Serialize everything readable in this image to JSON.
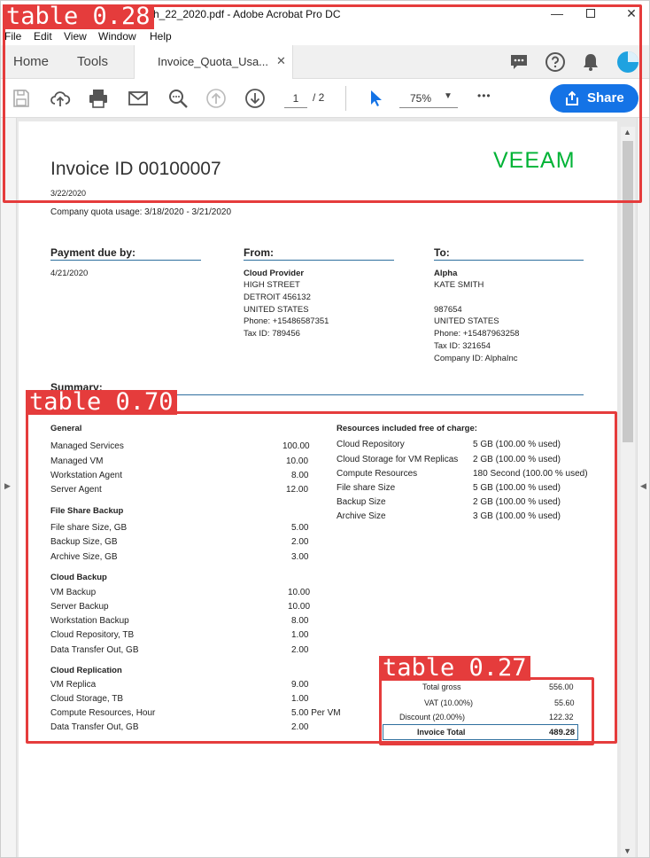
{
  "window": {
    "title": "ch_22_2020.pdf - Adobe Acrobat Pro DC"
  },
  "menu": [
    "File",
    "Edit",
    "View",
    "Window",
    "Help"
  ],
  "tabs": {
    "home": "Home",
    "tools": "Tools",
    "document": "Invoice_Quota_Usa...",
    "close": "✕"
  },
  "toolbar": {
    "page_current": "1",
    "page_total": "/ 2",
    "zoom": "75%",
    "more": "•••",
    "share_label": "Share"
  },
  "invoice": {
    "title": "Invoice ID 00100007",
    "logo": "VEEAM",
    "date": "3/22/2020",
    "quota_usage": "Company quota usage: 3/18/2020 - 3/21/2020",
    "payment": {
      "heading": "Payment due by:",
      "date": "4/21/2020"
    },
    "from": {
      "heading": "From:",
      "name": "Cloud Provider",
      "lines": [
        "HIGH STREET",
        "DETROIT 456132",
        "UNITED STATES",
        "Phone: +15486587351",
        "Tax ID: 789456"
      ]
    },
    "to": {
      "heading": "To:",
      "name": "Alpha",
      "lines": [
        "KATE SMITH",
        "",
        "987654",
        "UNITED STATES",
        "Phone: +15487963258",
        "Tax ID: 321654",
        "Company ID: AlphaInc"
      ]
    },
    "summary_heading": "Summary:",
    "sections": [
      {
        "heading": "General",
        "rows": [
          [
            "Managed Services",
            "100.00"
          ],
          [
            "Managed VM",
            "10.00"
          ],
          [
            "Workstation Agent",
            "8.00"
          ],
          [
            "Server Agent",
            "12.00"
          ]
        ]
      },
      {
        "heading": "File Share Backup",
        "rows": [
          [
            "File share Size, GB",
            "5.00"
          ],
          [
            "Backup Size, GB",
            "2.00"
          ],
          [
            "Archive Size, GB",
            "3.00"
          ]
        ]
      },
      {
        "heading": "Cloud Backup",
        "rows": [
          [
            "VM Backup",
            "10.00"
          ],
          [
            "Server Backup",
            "10.00"
          ],
          [
            "Workstation Backup",
            "8.00"
          ],
          [
            "Cloud Repository, TB",
            "1.00"
          ],
          [
            "Data Transfer Out, GB",
            "2.00"
          ]
        ]
      },
      {
        "heading": "Cloud Replication",
        "rows": [
          [
            "VM Replica",
            "9.00"
          ],
          [
            "Cloud Storage, TB",
            "1.00"
          ],
          [
            "Compute Resources, Hour",
            "5.00 Per VM"
          ],
          [
            "Data Transfer Out, GB",
            "2.00"
          ]
        ]
      }
    ],
    "free_resources": {
      "heading": "Resources included free of charge:",
      "rows": [
        [
          "Cloud Repository",
          "5 GB (100.00 % used)"
        ],
        [
          "Cloud Storage for VM Replicas",
          "2 GB (100.00 % used)"
        ],
        [
          "Compute Resources",
          "180 Second (100.00 % used)"
        ],
        [
          "File share Size",
          "5 GB (100.00 % used)"
        ],
        [
          "Backup Size",
          "2 GB (100.00 % used)"
        ],
        [
          "Archive Size",
          "3 GB (100.00 % used)"
        ]
      ]
    },
    "totals": [
      [
        "Total gross",
        "556.00"
      ],
      [
        "VAT (10.00%)",
        "55.60"
      ],
      [
        "Discount (20.00%)",
        "122.32"
      ],
      [
        "Invoice Total",
        "489.28"
      ]
    ]
  },
  "annotations": [
    {
      "label": "table 0.28"
    },
    {
      "label": "table 0.70"
    },
    {
      "label": "table 0.27"
    }
  ],
  "colors": {
    "accent": "#1473e6",
    "logo": "#00b336",
    "annotation": "#e53c3c",
    "rule": "#2e6f9e"
  }
}
